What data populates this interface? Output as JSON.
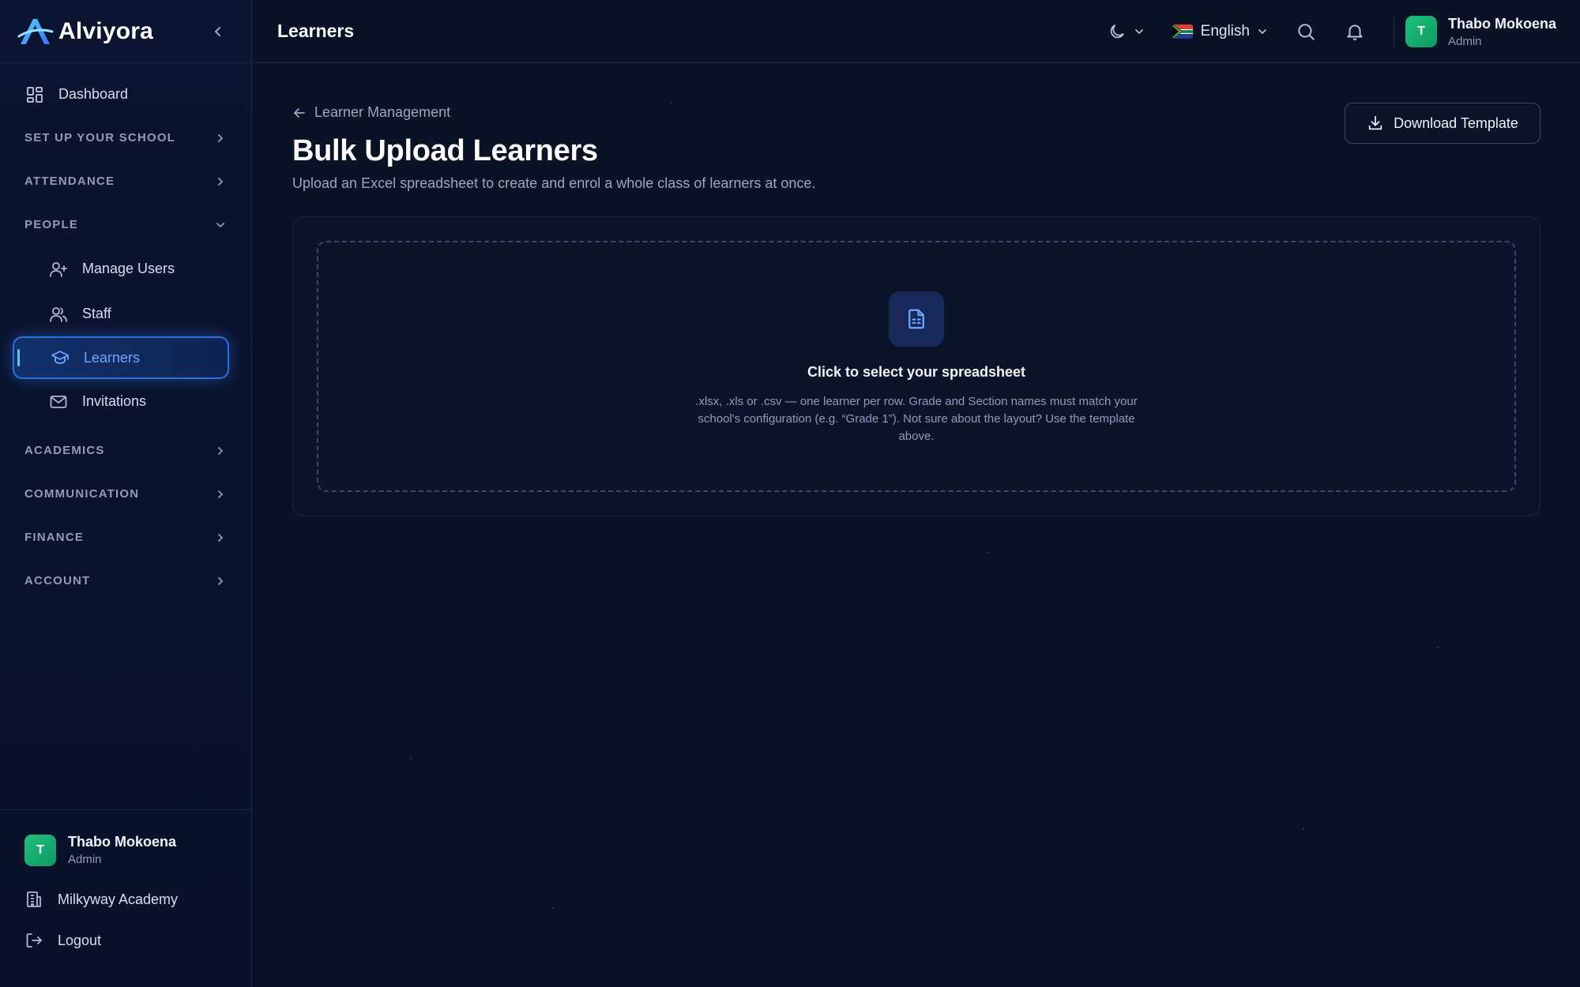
{
  "brand": {
    "name": "Alviyora"
  },
  "sidebar": {
    "dashboard_label": "Dashboard",
    "sections": [
      {
        "label": "SET UP YOUR SCHOOL"
      },
      {
        "label": "ATTENDANCE"
      },
      {
        "label": "PEOPLE"
      },
      {
        "label": "ACADEMICS"
      },
      {
        "label": "COMMUNICATION"
      },
      {
        "label": "FINANCE"
      },
      {
        "label": "ACCOUNT"
      }
    ],
    "people_items": [
      {
        "label": "Manage Users",
        "icon": "user-plus-icon"
      },
      {
        "label": "Staff",
        "icon": "users-icon"
      },
      {
        "label": "Learners",
        "icon": "graduation-cap-icon",
        "active": true
      },
      {
        "label": "Invitations",
        "icon": "mail-icon"
      }
    ],
    "footer": {
      "user_initial": "T",
      "user_name": "Thabo Mokoena",
      "user_role": "Admin",
      "school_label": "Milkyway Academy",
      "logout_label": "Logout"
    }
  },
  "topbar": {
    "title": "Learners",
    "language": "English",
    "user_initial": "T",
    "user_name": "Thabo Mokoena",
    "user_role": "Admin"
  },
  "main": {
    "breadcrumb": "Learner Management",
    "title": "Bulk Upload Learners",
    "subtitle": "Upload an Excel spreadsheet to create and enrol a whole class of learners at once.",
    "download_label": "Download Template",
    "dropzone": {
      "title": "Click to select your spreadsheet",
      "description": ".xlsx, .xls or .csv — one learner per row. Grade and Section names must match your school's configuration (e.g. “Grade 1”). Not sure about the layout? Use the template above."
    }
  },
  "colors": {
    "accent": "#2f6fd8",
    "avatar": "#1fbf7a",
    "background": "#0a1226"
  }
}
